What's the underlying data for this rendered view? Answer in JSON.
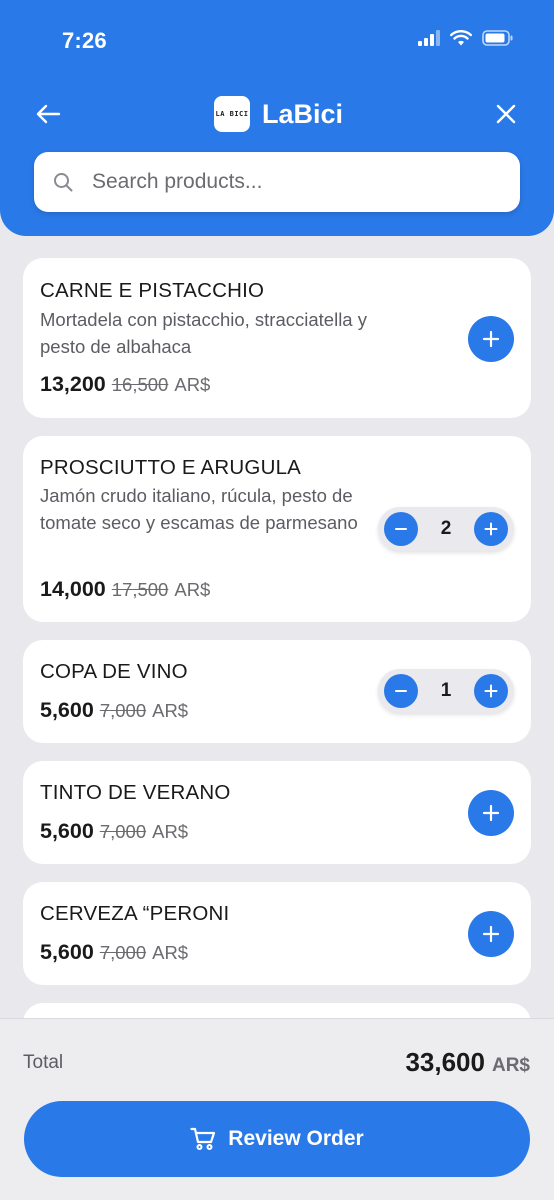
{
  "status_bar": {
    "time": "7:26"
  },
  "header": {
    "brand_logo_text": "LA BICI",
    "brand_name": "LaBici"
  },
  "search": {
    "placeholder": "Search products..."
  },
  "products": [
    {
      "name": "CARNE E PISTACCHIO",
      "description": "Mortadela con pistacchio, stracciatella y pesto de albahaca",
      "price": "13,200",
      "old_price": "16,500",
      "currency": "AR$"
    },
    {
      "name": "PROSCIUTTO E ARUGULA",
      "description": "Jamón crudo italiano, rúcula, pesto de tomate seco y escamas de parmesano",
      "price": "14,000",
      "old_price": "17,500",
      "currency": "AR$",
      "quantity": "2"
    },
    {
      "name": "COPA DE VINO",
      "price": "5,600",
      "old_price": "7,000",
      "currency": "AR$",
      "quantity": "1"
    },
    {
      "name": "TINTO DE VERANO",
      "price": "5,600",
      "old_price": "7,000",
      "currency": "AR$"
    },
    {
      "name": "CERVEZA “PERONI",
      "price": "5,600",
      "old_price": "7,000",
      "currency": "AR$"
    }
  ],
  "footer": {
    "total_label": "Total",
    "total_amount": "33,600",
    "total_currency": "AR$",
    "review_label": "Review Order"
  },
  "colors": {
    "accent": "#2A79E8",
    "background": "#E8E8ED"
  }
}
